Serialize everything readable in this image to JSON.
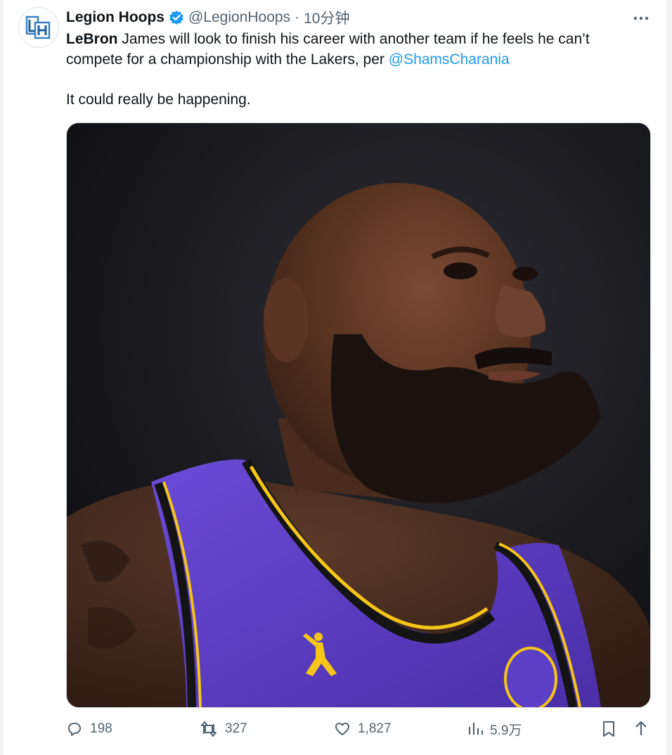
{
  "tweet": {
    "display_name": "Legion Hoops",
    "handle": "@LegionHoops",
    "separator": "·",
    "time": "10分钟",
    "text_bold": "LeBron",
    "text_main": " James will look to finish his career with another team if he feels he can’t compete for a championship with the Lakers, per ",
    "mention": "@ShamsCharania",
    "text_second": "It could really be happening.",
    "media_alt": "LeBron James in a purple Lakers jersey looking upward",
    "verified": true,
    "avatar_logo": "LH"
  },
  "actions": {
    "replies": "198",
    "retweets": "327",
    "likes": "1,827",
    "views": "5.9万"
  },
  "icons": {
    "verified": "verified-badge-icon",
    "more": "more-options-icon",
    "reply": "reply-icon",
    "retweet": "retweet-icon",
    "like": "heart-icon",
    "views": "views-chart-icon",
    "bookmark": "bookmark-icon",
    "share": "share-icon"
  },
  "colors": {
    "accent": "#1d9bf0",
    "text": "#0f1419",
    "muted": "#536471",
    "jersey_purple": "#5b3fc4",
    "jersey_gold": "#f5c518"
  }
}
